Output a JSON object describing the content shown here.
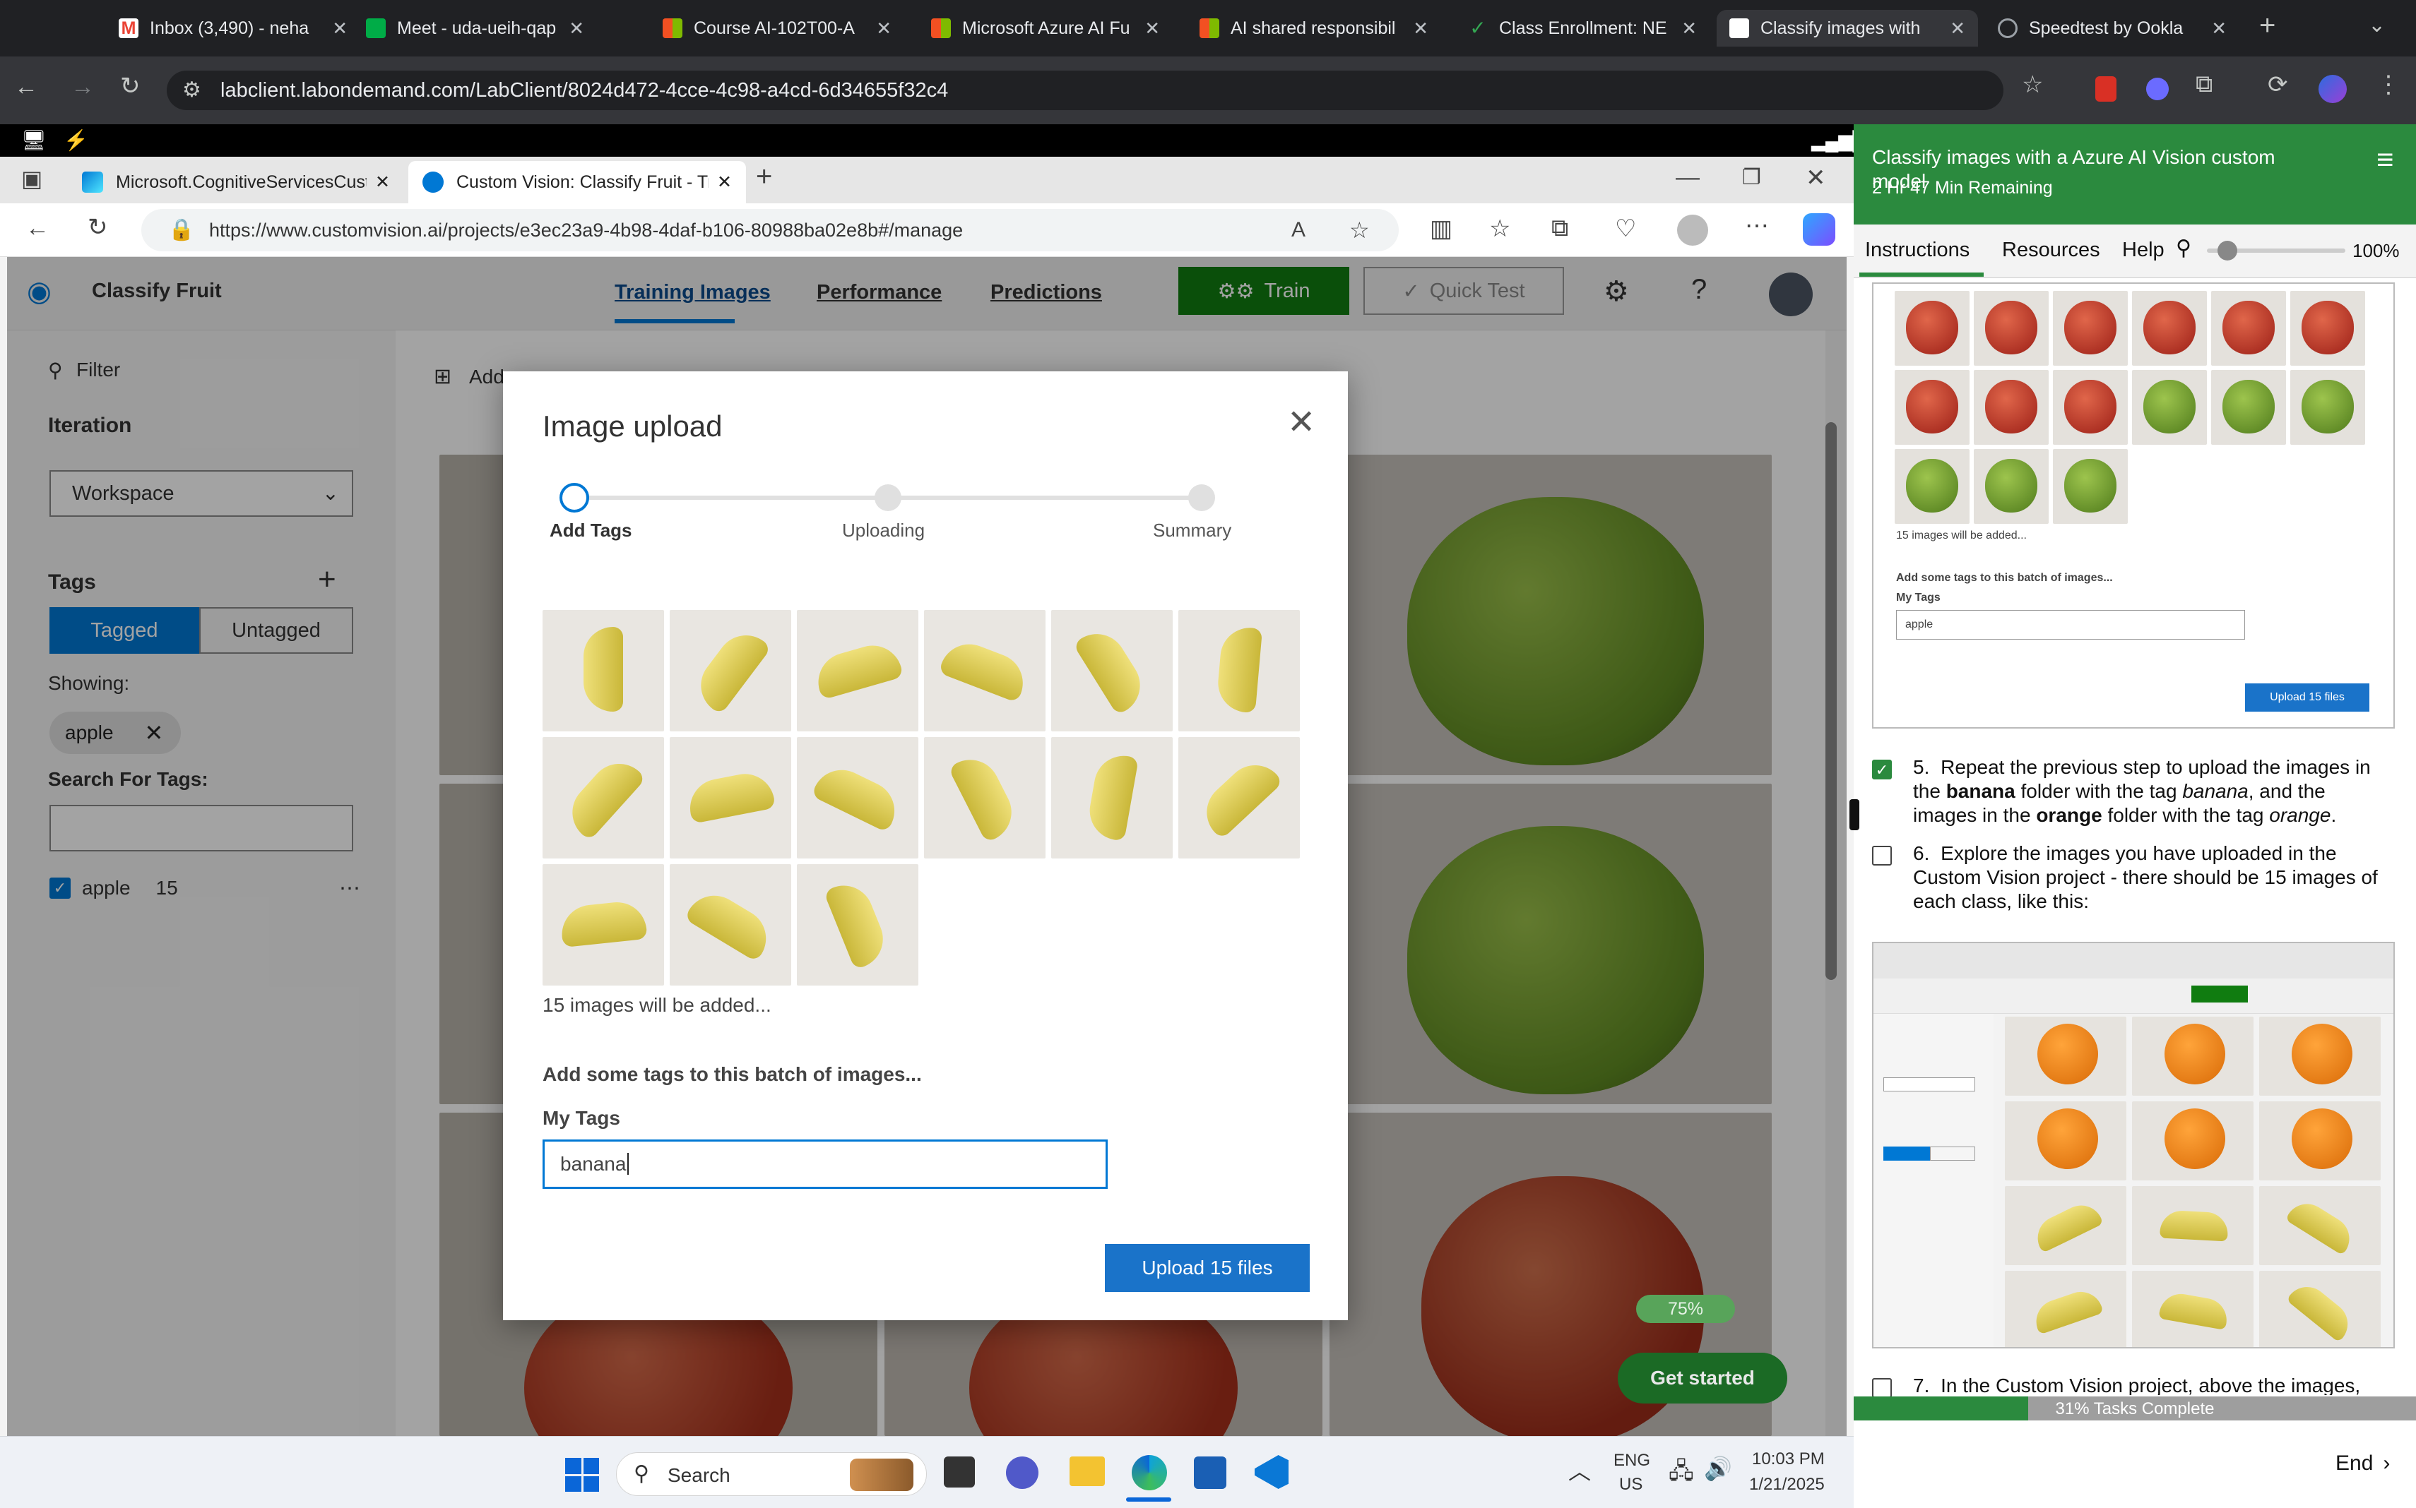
{
  "browser": {
    "tabs": [
      {
        "title": "Inbox (3,490) - neha",
        "icon": "gmail-icon",
        "color": "#ea4335"
      },
      {
        "title": "Meet - uda-ueih-qap",
        "icon": "meet-icon",
        "color": "#00ac47"
      },
      {
        "title": "Course AI-102T00-A",
        "icon": "microsoft-icon",
        "color": "#f25022"
      },
      {
        "title": "Microsoft Azure AI Fu",
        "icon": "microsoft-icon",
        "color": "#f25022"
      },
      {
        "title": "AI shared responsibil",
        "icon": "microsoft-icon",
        "color": "#f25022"
      },
      {
        "title": "Class Enrollment: NE",
        "icon": "check-icon",
        "color": "#34a853"
      },
      {
        "title": "Classify images with",
        "icon": "lab-icon",
        "color": "#ffffff"
      },
      {
        "title": "Speedtest by Ookla",
        "icon": "speedtest-icon",
        "color": "#9aa0a6"
      }
    ],
    "url": "labclient.labondemand.com/LabClient/8024d472-4cce-4c98-a4cd-6d34655f32c4"
  },
  "edge": {
    "tabs": [
      {
        "title": "Microsoft.CognitiveServicesCusto"
      },
      {
        "title": "Custom Vision: Classify Fruit - Tra"
      }
    ],
    "url": "https://www.customvision.ai/projects/e3ec23a9-4b98-4daf-b106-80988ba02e8b#/manage"
  },
  "cv": {
    "project_name": "Classify Fruit",
    "nav": [
      "Training Images",
      "Performance",
      "Predictions"
    ],
    "train_label": "Train",
    "quick_test_label": "Quick Test",
    "filter_label": "Filter",
    "iteration_label": "Iteration",
    "iteration_value": "Workspace",
    "tags_label": "Tags",
    "tagged_label": "Tagged",
    "untagged_label": "Untagged",
    "showing_label": "Showing:",
    "showing_chip": "apple",
    "search_tags_label": "Search For Tags:",
    "tag_list": [
      {
        "name": "apple",
        "count": "15"
      }
    ],
    "toolbar_add": "Add"
  },
  "modal": {
    "title": "Image upload",
    "steps": [
      "Add Tags",
      "Uploading",
      "Summary"
    ],
    "images_count_text": "15 images will be added...",
    "add_tags_heading": "Add some tags to this batch of images...",
    "my_tags_label": "My Tags",
    "tag_input_value": "banana",
    "upload_button": "Upload 15 files"
  },
  "onboarding": {
    "progress_label": "75%",
    "get_started": "Get started"
  },
  "taskbar": {
    "search_placeholder": "Search",
    "lang_top": "ENG",
    "lang_bottom": "US",
    "time": "10:03 PM",
    "date": "1/21/2025"
  },
  "lab": {
    "title": "Classify images with a Azure AI Vision custom model",
    "remaining": "2 Hr 47 Min Remaining",
    "tabs": [
      "Instructions",
      "Resources",
      "Help"
    ],
    "zoom": "100%",
    "zoom_level": 0.15,
    "preview": {
      "count_text": "15 images will be added...",
      "add_tags_heading": "Add some tags to this batch of images...",
      "my_tags_label": "My Tags",
      "tag_value": "apple",
      "upload_button": "Upload 15 files"
    },
    "step5": {
      "num": "5.",
      "text_a": "Repeat the previous step to upload the images in the ",
      "bold_a": "banana",
      "text_b": " folder with the tag ",
      "ital_a": "banana",
      "text_c": ", and the images in the ",
      "bold_b": "orange",
      "text_d": " folder with the tag ",
      "ital_b": "orange",
      "text_e": "."
    },
    "step6": {
      "num": "6.",
      "text": "Explore the images you have uploaded in the Custom Vision project - there should be 15 images of each class, like this:"
    },
    "step7": {
      "num": "7.",
      "text": "In the Custom Vision project, above the images,"
    },
    "tasks_complete": "31% Tasks Complete",
    "tasks_fraction": 0.31,
    "end_label": "End"
  }
}
